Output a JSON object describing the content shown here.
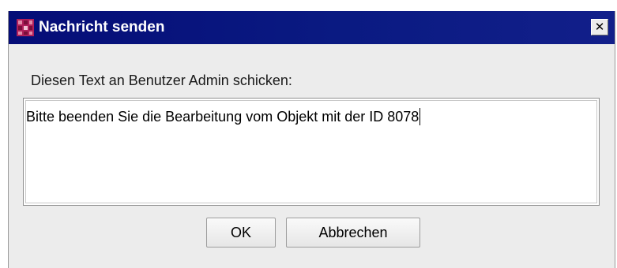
{
  "window": {
    "title": "Nachricht senden",
    "app_icon": "app-logo-icon",
    "close_icon": "close-icon",
    "close_glyph": "✕"
  },
  "dialog": {
    "prompt": "Diesen Text an Benutzer Admin schicken:",
    "message_value": "Bitte beenden Sie die Bearbeitung vom Objekt mit der ID 8078"
  },
  "buttons": {
    "ok_label": "OK",
    "cancel_label": "Abbrechen"
  },
  "colors": {
    "titlebar": "#050d77",
    "dialog_bg": "#ececec",
    "icon_accent": "#b01f5a"
  }
}
